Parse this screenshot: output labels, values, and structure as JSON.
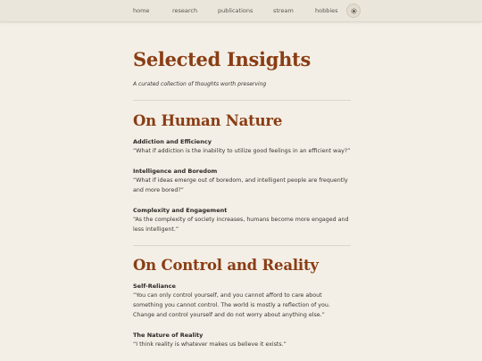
{
  "nav": {
    "items": [
      {
        "label": "home"
      },
      {
        "label": "research"
      },
      {
        "label": "publications"
      },
      {
        "label": "stream"
      },
      {
        "label": "hobbies"
      }
    ],
    "theme_icon": "sun-icon"
  },
  "page": {
    "title": "Selected Insights",
    "subtitle": "A curated collection of thoughts worth preserving"
  },
  "sections": [
    {
      "title": "On Human Nature",
      "entries": [
        {
          "title": "Addiction and Efficiency",
          "quote": "“What if addiction is the inability to utilize good feelings in an efficient way?”"
        },
        {
          "title": "Intelligence and Boredom",
          "quote": "“What if ideas emerge out of boredom, and intelligent people are frequently and more bored?”"
        },
        {
          "title": "Complexity and Engagement",
          "quote": "“As the complexity of society increases, humans become more engaged and less intelligent.”"
        }
      ]
    },
    {
      "title": "On Control and Reality",
      "entries": [
        {
          "title": "Self-Reliance",
          "quote": "“You can only control yourself, and you cannot afford to care about something you cannot control. The world is mostly a reflection of you. Change and control yourself and do not worry about anything else.”"
        },
        {
          "title": "The Nature of Reality",
          "quote": "“I think reality is whatever makes us believe it exists.”"
        }
      ]
    }
  ]
}
